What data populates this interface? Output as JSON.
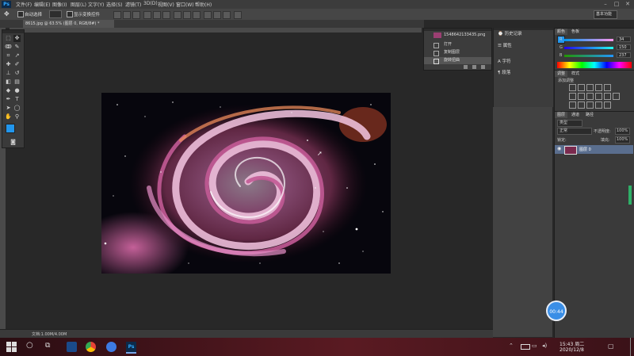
{
  "app": {
    "logo": "Ps"
  },
  "menubar": {
    "items": [
      "文件(F)",
      "编辑(E)",
      "图像(I)",
      "图层(L)",
      "文字(Y)",
      "选择(S)",
      "滤镜(T)",
      "3D(D)",
      "视图(V)",
      "窗口(W)",
      "帮助(H)"
    ],
    "window_controls": {
      "minimize": "–",
      "maximize": "□",
      "close": "✕"
    }
  },
  "optionsbar": {
    "auto_select_label": "自动选择",
    "transform_label": "显示变换控件",
    "workspace_preset": "基本功能"
  },
  "document": {
    "tab_label": "8615.jpg @ 63.5% (图层 0, RGB/8#) *",
    "status": "文档:1.00M/4.00M"
  },
  "history": {
    "snapshot_name": "1548642133435.png",
    "items": [
      "打开",
      "复制图层",
      "旋转扭曲"
    ],
    "selected_index": 2
  },
  "midpanel": {
    "items": [
      "历史记录",
      "属性",
      "字符",
      "段落"
    ]
  },
  "color_panel": {
    "tabs": [
      "颜色",
      "色板"
    ],
    "sliders": [
      {
        "label": "R",
        "value": "34"
      },
      {
        "label": "G",
        "value": "150"
      },
      {
        "label": "B",
        "value": "237"
      }
    ],
    "foreground": "#2296ed",
    "background": "#ffffff"
  },
  "adjustments_panel": {
    "tabs": [
      "调整",
      "样式"
    ],
    "heading": "添加调整"
  },
  "layers_panel": {
    "tabs": [
      "图层",
      "通道",
      "路径"
    ],
    "kind_filter": "类型",
    "blend_mode": "正常",
    "opacity_label": "不透明度:",
    "opacity_value": "100%",
    "lock_label": "锁定:",
    "fill_label": "填充:",
    "fill_value": "100%",
    "layer_name": "图层 0"
  },
  "timer": {
    "label": "00:44"
  },
  "taskbar": {
    "clock_time": "15:43 周二",
    "clock_date": "2020/12/8"
  }
}
